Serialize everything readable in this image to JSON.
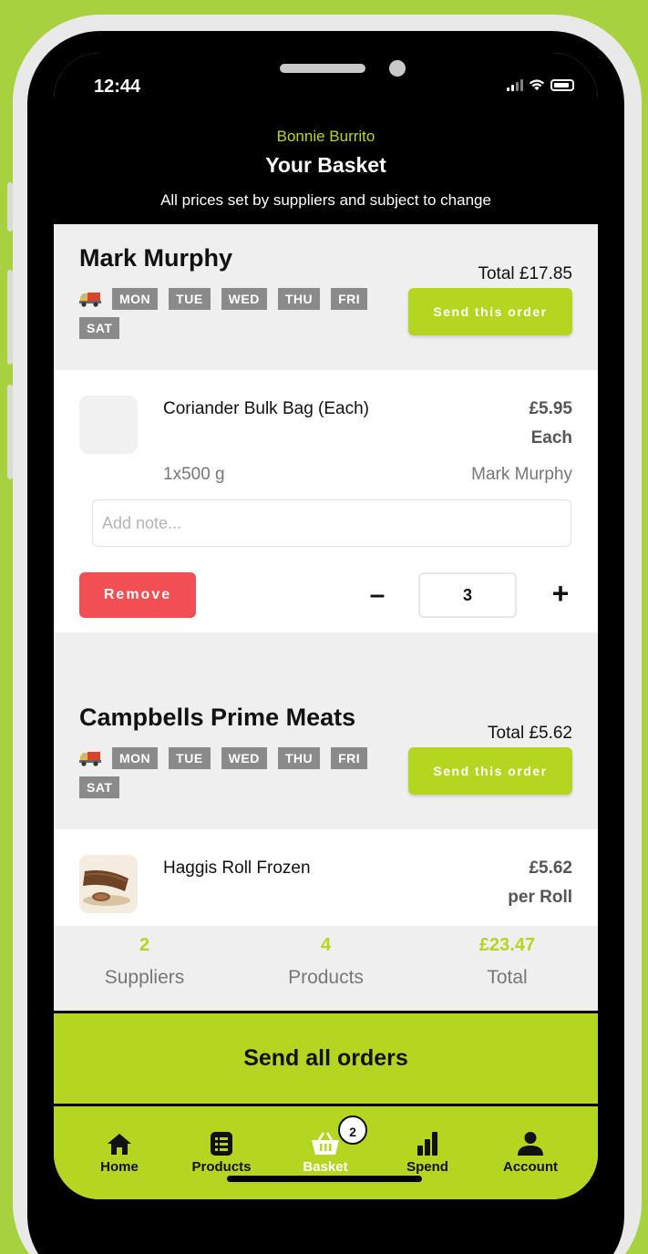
{
  "status_bar": {
    "time": "12:44"
  },
  "header": {
    "restaurant": "Bonnie Burrito",
    "title": "Your Basket",
    "subtitle": "All prices set by suppliers and subject to change"
  },
  "suppliers": [
    {
      "name": "Mark Murphy",
      "total": "Total £17.85",
      "days": [
        "MON",
        "TUE",
        "WED",
        "THU",
        "FRI",
        "SAT"
      ],
      "send_label": "Send this order",
      "item": {
        "name": "Coriander Bulk Bag (Each)",
        "price": "£5.95",
        "unit": "Each",
        "size": "1x500 g",
        "supplier": "Mark Murphy",
        "note_placeholder": "Add note...",
        "remove_label": "Remove",
        "minus": "–",
        "quantity": "3",
        "plus": "+"
      }
    },
    {
      "name": "Campbells Prime Meats",
      "total": "Total £5.62",
      "days": [
        "MON",
        "TUE",
        "WED",
        "THU",
        "FRI",
        "SAT"
      ],
      "send_label": "Send this order",
      "item": {
        "name": "Haggis Roll Frozen",
        "price": "£5.62",
        "unit": "per Roll"
      }
    }
  ],
  "summary": {
    "suppliers_count": "2",
    "suppliers_label": "Suppliers",
    "products_count": "4",
    "products_label": "Products",
    "total_value": "£23.47",
    "total_label": "Total"
  },
  "send_all_label": "Send all orders",
  "tabs": [
    {
      "label": "Home",
      "icon": "home-icon"
    },
    {
      "label": "Products",
      "icon": "products-icon"
    },
    {
      "label": "Basket",
      "icon": "basket-icon",
      "badge": "2"
    },
    {
      "label": "Spend",
      "icon": "spend-icon"
    },
    {
      "label": "Account",
      "icon": "account-icon"
    }
  ],
  "colors": {
    "accent": "#b5d621",
    "background": "#a8d13f",
    "remove": "#f24f55",
    "day_chip": "#8a8a8a"
  }
}
